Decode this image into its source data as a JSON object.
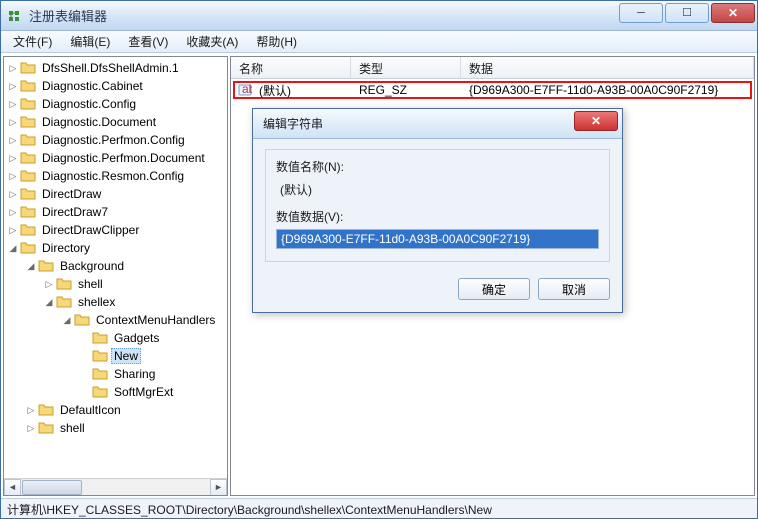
{
  "window": {
    "title": "注册表编辑器"
  },
  "menu": {
    "file": "文件(F)",
    "edit": "编辑(E)",
    "view": "查看(V)",
    "favorites": "收藏夹(A)",
    "help": "帮助(H)"
  },
  "tree": {
    "n0": "DfsShell.DfsShellAdmin.1",
    "n1": "Diagnostic.Cabinet",
    "n2": "Diagnostic.Config",
    "n3": "Diagnostic.Document",
    "n4": "Diagnostic.Perfmon.Config",
    "n5": "Diagnostic.Perfmon.Document",
    "n6": "Diagnostic.Resmon.Config",
    "n7": "DirectDraw",
    "n8": "DirectDraw7",
    "n9": "DirectDrawClipper",
    "n10": "Directory",
    "n11": "Background",
    "n12": "shell",
    "n13": "shellex",
    "n14": "ContextMenuHandlers",
    "n15": "Gadgets",
    "n16": "New",
    "n17": "Sharing",
    "n18": "SoftMgrExt",
    "n19": "DefaultIcon",
    "n20": "shell"
  },
  "columns": {
    "name": "名称",
    "type": "类型",
    "data": "数据"
  },
  "colWidths": {
    "name": 120,
    "type": 110,
    "data": 280
  },
  "row": {
    "name": "(默认)",
    "type": "REG_SZ",
    "data": "{D969A300-E7FF-11d0-A93B-00A0C90F2719}"
  },
  "dialog": {
    "title": "编辑字符串",
    "nameLabel": "数值名称(N):",
    "nameValue": "(默认)",
    "dataLabel": "数值数据(V):",
    "dataValue": "{D969A300-E7FF-11d0-A93B-00A0C90F2719}",
    "ok": "确定",
    "cancel": "取消"
  },
  "status": "计算机\\HKEY_CLASSES_ROOT\\Directory\\Background\\shellex\\ContextMenuHandlers\\New"
}
